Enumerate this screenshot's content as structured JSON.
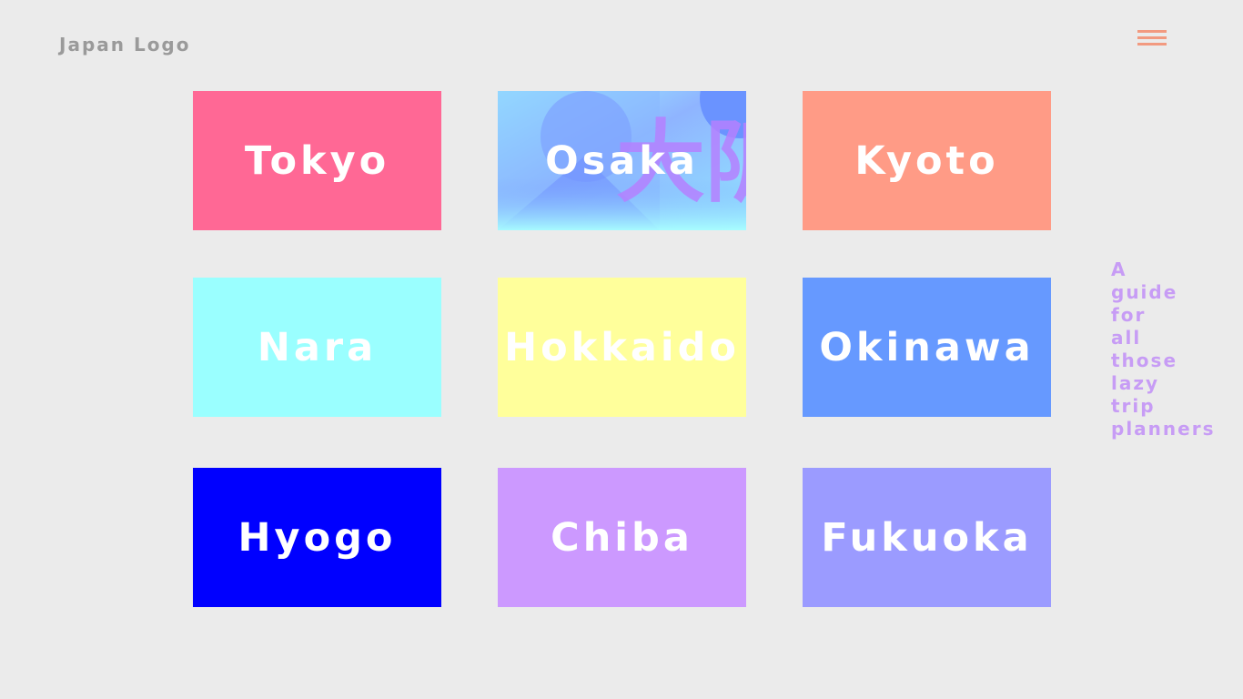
{
  "header": {
    "logo": "Japan Logo"
  },
  "menu": {
    "icon": "hamburger-menu-icon",
    "color": "#f29a80"
  },
  "tiles": [
    {
      "label": "Tokyo",
      "color": "#ff6895"
    },
    {
      "label": "Osaka",
      "color": "#8fd6ff",
      "background": "osaka-kanji-artwork"
    },
    {
      "label": "Kyoto",
      "color": "#ff9b86"
    },
    {
      "label": "Nara",
      "color": "#9affff"
    },
    {
      "label": "Hokkaido",
      "color": "#ffff9b"
    },
    {
      "label": "Okinawa",
      "color": "#6699ff"
    },
    {
      "label": "Hyogo",
      "color": "#0000ff"
    },
    {
      "label": "Chiba",
      "color": "#cc99ff"
    },
    {
      "label": "Fukuoka",
      "color": "#9b9bff"
    }
  ],
  "tagline": "A guide for all those lazy trip planners",
  "colors": {
    "background": "#ebebeb",
    "logo": "#9a9a9a",
    "tagline": "#c79cf5"
  }
}
